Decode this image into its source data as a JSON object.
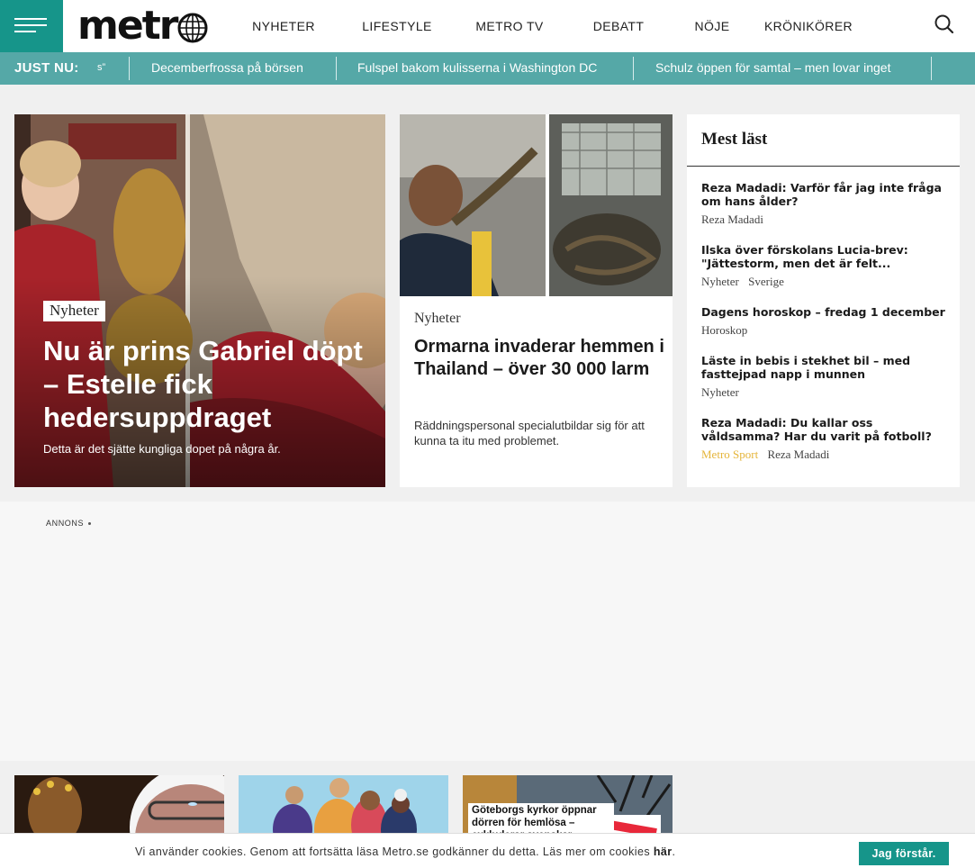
{
  "brand": {
    "logo_text": "metr",
    "accent": "#16958a",
    "ticker_bg": "#55a8a7"
  },
  "nav": {
    "items": [
      "NYHETER",
      "LIFESTYLE",
      "METRO TV",
      "DEBATT",
      "NÖJE",
      "KRÖNIKÖRER"
    ],
    "menu_icon": "hamburger-icon",
    "search_icon": "search-icon"
  },
  "ticker": {
    "label": "JUST NU:",
    "items": [
      "s”",
      "Decemberfrossa på börsen",
      "Fulspel bakom kulisserna i Washington DC",
      "Schulz öppen för samtal – men lovar inget"
    ]
  },
  "hero": {
    "tag": "Nyheter",
    "title": "Nu är prins Gabriel döpt – Estelle fick hedersuppdraget",
    "subtitle": "Detta är det sjätte kungliga dopet på några år."
  },
  "card2": {
    "tag": "Nyheter",
    "title": "Ormarna invaderar hemmen i Thailand – över 30 000 larm",
    "text": "Räddningspersonal specialutbildar sig för att kunna ta itu med problemet."
  },
  "most_read": {
    "title": "Mest läst",
    "items": [
      {
        "headline": "Reza Madadi: Varför får jag inte fråga om hans ålder?",
        "meta": [
          "Reza Madadi"
        ]
      },
      {
        "headline": "Ilska över förskolans Lucia-brev: \"Jättestorm, men det är felt...",
        "meta": [
          "Nyheter",
          "Sverige"
        ]
      },
      {
        "headline": "Dagens horoskop – fredag 1 december",
        "meta": [
          "Horoskop"
        ]
      },
      {
        "headline": "Läste in bebis i stekhet bil – med fasttejpad napp i munnen",
        "meta": [
          "Nyheter"
        ]
      },
      {
        "headline": "Reza Madadi: Du kallar oss våldsamma? Har du varit på fotboll?",
        "meta": [
          "Metro Sport",
          "Reza Madadi"
        ]
      }
    ]
  },
  "ad": {
    "label": "ANNONS"
  },
  "bottom_cards": {
    "card3_label": "Göteborgs kyrkor öppnar dörren för hemlösa – exkluderar svenskar"
  },
  "cookie": {
    "text": "Vi använder cookies. Genom att fortsätta läsa Metro.se godkänner du detta. Läs mer om cookies ",
    "link": "här",
    "link_suffix": ".",
    "button": "Jag förstår."
  }
}
